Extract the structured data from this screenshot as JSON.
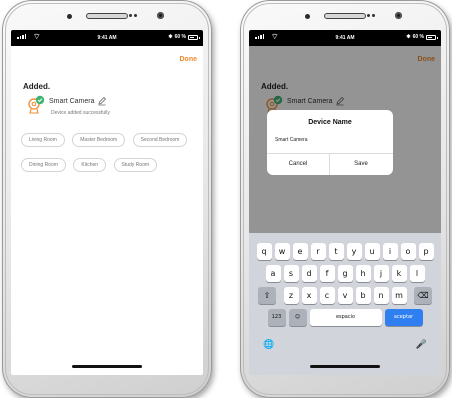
{
  "status_bar": {
    "time": "9:41 AM",
    "battery": "60 %"
  },
  "app": {
    "done_label": "Done",
    "added_title": "Added.",
    "device_name": "Smart Camera",
    "device_subtitle": "Device added successfully",
    "rooms": [
      "Living Room",
      "Master Bedroom",
      "Second Bedroom",
      "Dining Room",
      "Kitchen",
      "Study Room"
    ]
  },
  "dialog": {
    "title": "Device Name",
    "input_value": "Smart Camera",
    "cancel_label": "Cancel",
    "save_label": "Save"
  },
  "keyboard": {
    "row1": [
      "q",
      "w",
      "e",
      "r",
      "t",
      "y",
      "u",
      "i",
      "o",
      "p"
    ],
    "row2": [
      "a",
      "s",
      "d",
      "f",
      "g",
      "h",
      "j",
      "k",
      "l"
    ],
    "row3": [
      "z",
      "x",
      "c",
      "v",
      "b",
      "n",
      "m"
    ],
    "shift_symbol": "⇧",
    "delete_symbol": "⌫",
    "numbers_label": "123",
    "emoji_symbol": "☺",
    "space_label": "espacio",
    "return_label": "aceptar",
    "globe_symbol": "🌐",
    "mic_symbol": "🎤"
  },
  "colors": {
    "accent": "#f28a30",
    "success": "#3cb371",
    "keyboard_return": "#2f7ff0"
  }
}
